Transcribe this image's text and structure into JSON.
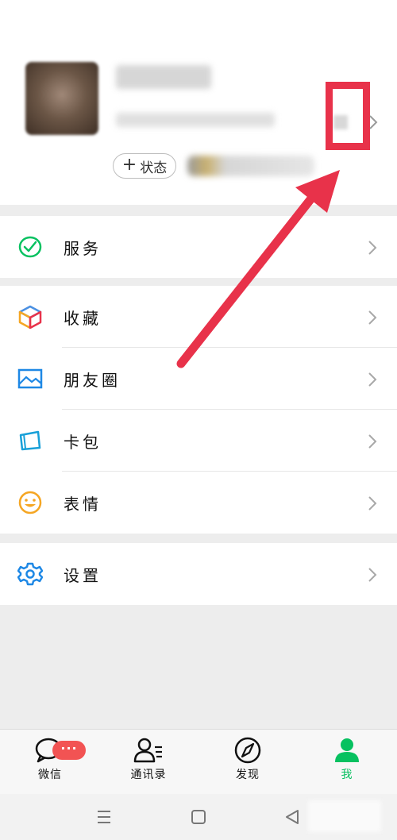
{
  "profile": {
    "status_button_label": "状态",
    "status_button_prefix": "+"
  },
  "menu": {
    "services": {
      "label": "服务",
      "icon": "services-icon"
    },
    "favorites": {
      "label": "收藏",
      "icon": "favorites-cube-icon"
    },
    "moments": {
      "label": "朋友圈",
      "icon": "moments-image-icon"
    },
    "wallet": {
      "label": "卡包",
      "icon": "card-wallet-icon"
    },
    "stickers": {
      "label": "表情",
      "icon": "smiley-icon"
    },
    "settings": {
      "label": "设置",
      "icon": "gear-icon"
    }
  },
  "tabbar": {
    "chats": {
      "label": "微信",
      "badge": "···"
    },
    "contacts": {
      "label": "通讯录"
    },
    "discover": {
      "label": "发现"
    },
    "me": {
      "label": "我"
    }
  },
  "colors": {
    "accent": "#07c160",
    "annotation": "#e8324a",
    "badge": "#f25353"
  }
}
